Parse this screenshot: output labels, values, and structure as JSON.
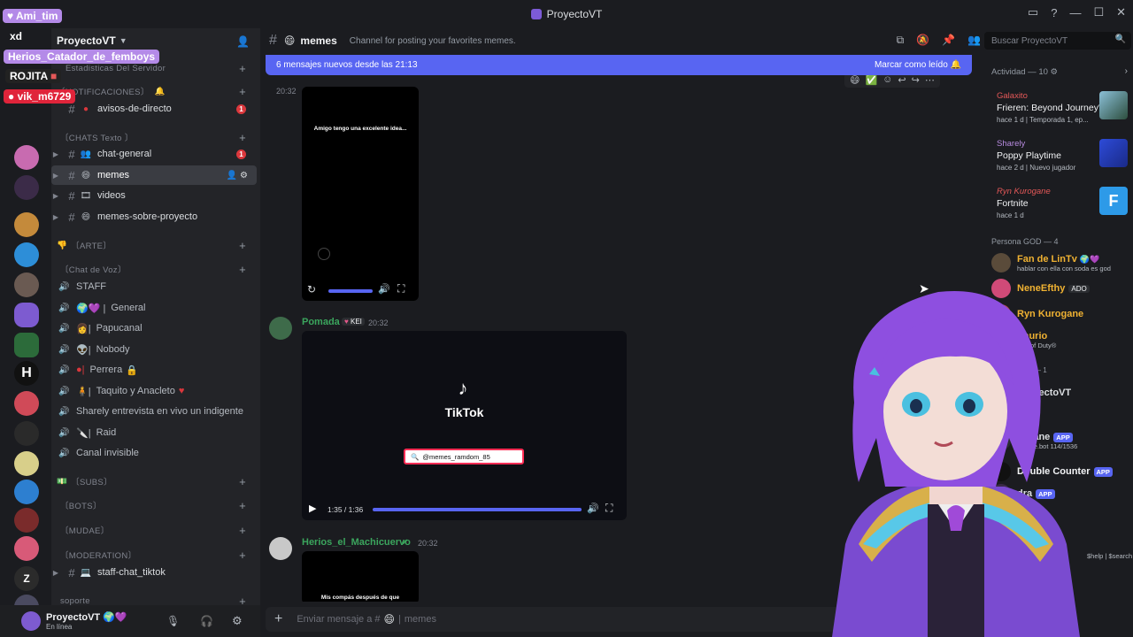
{
  "window": {
    "title": "ProyectoVT"
  },
  "server": {
    "name": "ProyectoVT"
  },
  "overlay_labels": {
    "tag1": "Ami_tim",
    "tag2": "xd",
    "tag3": "Herios_Catador_de_femboys",
    "tag4": "ROJITA",
    "tag5": "vik_m6729"
  },
  "sidebar": {
    "cat_stats": "Estadisticas Del Servidor",
    "cat_notif": "〔NOTIFICACIONES〕",
    "ch_avisos": "avisos-de-directo",
    "cat_chats": "〔CHATS Texto 〕",
    "ch_chat_general": "chat-general",
    "ch_memes": "memes",
    "ch_videos": "videos",
    "ch_memes_proy": "memes-sobre-proyecto",
    "cat_arte": "〔ARTE〕",
    "cat_voz": "〔Chat de Voz〕",
    "v_staff": "STAFF",
    "v_general": "General",
    "v_papucanal": "Papucanal",
    "v_nobody": "Nobody",
    "v_perrera": "Perrera",
    "v_taquito": "Taquito y Anacleto",
    "v_sharely": "Sharely entrevista en vivo un indigente",
    "v_raid": "Raid",
    "v_canal": "Canal invisible",
    "cat_subs": "〔SUBS〕",
    "cat_bots": "〔BOTS〕",
    "cat_mudae": "〔MUDAE〕",
    "cat_mod": "〔MODERATION〕",
    "ch_staff_tiktok": "staff-chat_tiktok",
    "cat_soporte": "soporte",
    "badge": "1"
  },
  "user": {
    "name": "ProyectoVT",
    "status": "En línea"
  },
  "header": {
    "channel": "memes",
    "topic": "Channel for posting your favorites memes.",
    "search_placeholder": "Buscar ProyectoVT"
  },
  "banner": {
    "text": "6 mensajes nuevos desde las 21:13",
    "mark_read": "Marcar como leído"
  },
  "messages": {
    "m1_time": "20:32",
    "m1_caption": "Amigo tengo una excelente idea...",
    "m2_user": "Pomada",
    "m2_tag": "KEI",
    "m2_time": "20:32",
    "m2_tiktok": "TikTok",
    "m2_handle": "@memes_ramdom_85",
    "m2_duration": "1:35 / 1:36",
    "m3_user": "Herios_el_Machicuervo",
    "m3_time": "20:32",
    "m3_caption": "Mis compás después de que"
  },
  "composer": {
    "placeholder": "Enviar mensaje a #",
    "channel": "memes"
  },
  "activity": {
    "header": "Actividad — 10",
    "cards": [
      {
        "user": "Galaxito",
        "game": "Frieren: Beyond Journey's ...",
        "meta": "hace 1 d  |  Temporada 1, ep..."
      },
      {
        "user": "Sharely",
        "game": "Poppy Playtime",
        "meta": "hace 2 d  |  Nuevo jugador"
      },
      {
        "user": "Ryn Kurogane",
        "game": "Fortnite",
        "meta": "hace 1 d"
      }
    ]
  },
  "members": {
    "group_header": "Persona GOD — 4",
    "m1_name": "Fan de LinTv",
    "m1_status": "hablar con ella con soda es god",
    "m2_name": "NeneEfthy",
    "m2_tag": "ADO",
    "m3_name": "Ryn Kurogane",
    "m4_name": "Saurio",
    "m4_status": "Call of Duty®",
    "m5_name": "ProyectoVT",
    "m6_name": "Arcane",
    "m6_status": "arcane.bot 114/1536",
    "m7_name": "Double Counter",
    "m8_name": "dra",
    "app_badge": "APP",
    "group2_header": "— 1",
    "m9_status": "$help | $search"
  },
  "colors": {
    "accent": "#5865f2",
    "green_name": "#3ba55d",
    "vtuber_hair": "#8e4fe0"
  }
}
